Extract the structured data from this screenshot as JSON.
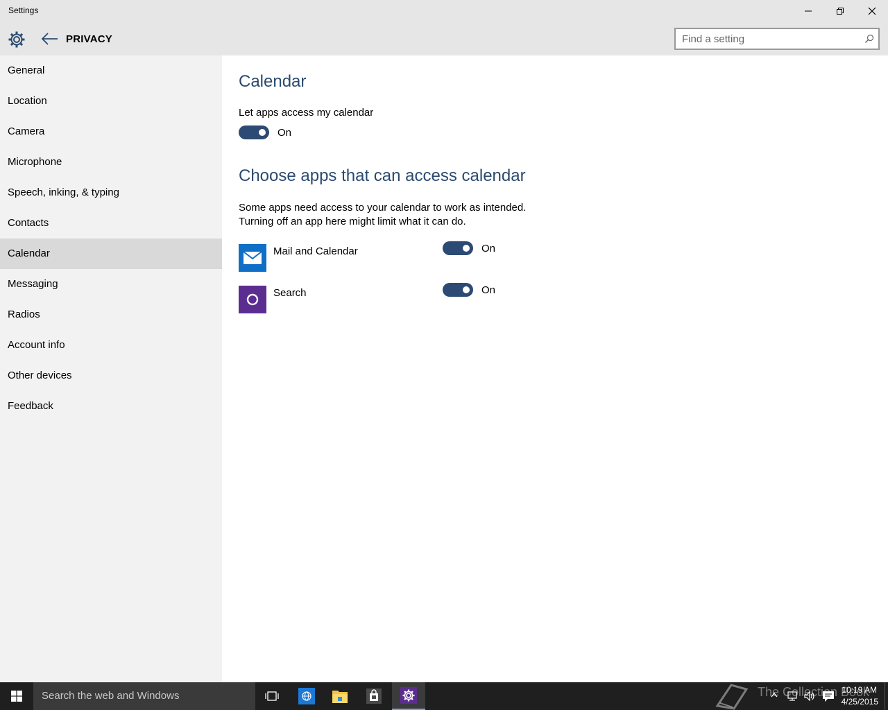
{
  "window": {
    "title": "Settings"
  },
  "header": {
    "page_title": "PRIVACY",
    "search_placeholder": "Find a setting"
  },
  "sidebar": {
    "items": [
      {
        "label": "General"
      },
      {
        "label": "Location"
      },
      {
        "label": "Camera"
      },
      {
        "label": "Microphone"
      },
      {
        "label": "Speech, inking, & typing"
      },
      {
        "label": "Contacts"
      },
      {
        "label": "Calendar",
        "selected": true
      },
      {
        "label": "Messaging"
      },
      {
        "label": "Radios"
      },
      {
        "label": "Account info"
      },
      {
        "label": "Other devices"
      },
      {
        "label": "Feedback"
      }
    ]
  },
  "main": {
    "title": "Calendar",
    "master_toggle": {
      "label": "Let apps access my calendar",
      "state": "On"
    },
    "apps_heading": "Choose apps that can access calendar",
    "description_line1": "Some apps need access to your calendar to work as intended.",
    "description_line2": "Turning off an app here might limit what it can do.",
    "apps": [
      {
        "name": "Mail and Calendar",
        "state": "On",
        "icon": "mail-icon",
        "color": "#0f6fc6"
      },
      {
        "name": "Search",
        "state": "On",
        "icon": "cortana-icon",
        "color": "#5c2d91"
      }
    ]
  },
  "taskbar": {
    "search_text": "Search the web and Windows",
    "time": "10:19 AM",
    "date": "4/25/2015",
    "watermark": "The Collection Book"
  },
  "colors": {
    "accent": "#2c4a74",
    "heading": "#2b4a6f",
    "sidebar_bg": "#f2f2f2",
    "selected_bg": "#d9d9d9",
    "taskbar_bg": "#1f1f1f"
  }
}
